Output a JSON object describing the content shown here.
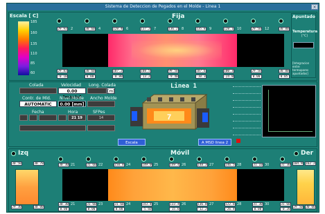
{
  "title": "Sistema de Deteccion de Pegados en el Molde - Linea 1",
  "scale": {
    "label": "Escala [ C]",
    "ticks": [
      "185",
      "160",
      "135",
      "110",
      "85",
      "60"
    ]
  },
  "fija": {
    "label": "Fija",
    "top_numbers": [
      "1",
      "2",
      "3",
      "4",
      "5",
      "6",
      "7",
      "8",
      "9",
      "10",
      "11",
      "12"
    ],
    "top_values": [
      "29.93",
      "30.60",
      "128.46",
      "137.20",
      "136.27",
      "135.81",
      "128.10",
      "29.50",
      "30.00"
    ],
    "bottom_numbers": [
      "13",
      "14",
      "15",
      "16",
      "17",
      "18",
      "19",
      "20",
      "21",
      "22",
      "23",
      "24"
    ],
    "bottom_values_a": [
      "29.83",
      "30.60",
      "107.20",
      "108.50",
      "99.50",
      "107.63",
      "100.30",
      "29.50",
      "30.00"
    ],
    "bottom_values_b": [
      "-0.10",
      "0.00",
      "-8.80",
      "-13.20",
      "-9.40",
      "-10.30",
      "-24.00",
      "0.00",
      "0.05"
    ]
  },
  "apuntado": {
    "label": "Apuntado",
    "temp_label": "Temperatura",
    "temp_unit": "[°C]",
    "note": "[Integracion entre termopares apuntados]"
  },
  "info": {
    "colada_label": "Colada",
    "velocidad_label": "Velocidad",
    "velocidad_value": "0.00 [m/min]",
    "long_colada_label": "Long. Colada",
    "long_colada_unit": "[m]",
    "mode_label": "Contr. de Mld.",
    "mode_value": "AUTOMATIC",
    "nivel_label": "Nivel Molde",
    "nivel_value": "0.00 [mm]",
    "ancho_label": "Ancho Molde",
    "fecha_label": "Fecha",
    "hora_label": "Hora",
    "hora_value": "21 19",
    "sfpes_label": "SFPes",
    "sfpes_value": "14"
  },
  "linea": {
    "title": "Linea  1",
    "center_number": "7",
    "btn_escala": "Escala",
    "btn_linea2": "A MSD linea 2"
  },
  "izq": {
    "label": "Izq",
    "values_top": [
      "30.50",
      "30.70"
    ],
    "values_bottom": [
      "29.30",
      "30.00"
    ]
  },
  "der": {
    "label": "Der",
    "values_top": [
      "104.90",
      "162.20"
    ],
    "values_bottom": [
      "29.50",
      "30.00"
    ]
  },
  "movil": {
    "label": "Móvil",
    "top_numbers": [
      "20",
      "21",
      "22",
      "23",
      "24",
      "25",
      "26",
      "27",
      "28",
      "29",
      "30",
      "31"
    ],
    "top_values": [
      "30.30",
      "31.60",
      "150.40",
      "149.00",
      "149.45",
      "148.30",
      "146.50",
      "31.10",
      "31.30"
    ],
    "bottom_numbers": [
      "19",
      "20",
      "21",
      "22",
      "23",
      "24",
      "25",
      "26",
      "27",
      "28",
      "29",
      "30"
    ],
    "bottom_values_a": [
      "30.30",
      "31.60",
      "31.60",
      "143.40",
      "133.40",
      "136.80",
      "122.60",
      "31.30",
      "31.60"
    ],
    "bottom_values_b": [
      "0.00",
      "0.00",
      "0.00",
      "-5.60",
      "-15.60",
      "-12.20",
      "-26.40",
      "0.00",
      "-0.20"
    ]
  }
}
